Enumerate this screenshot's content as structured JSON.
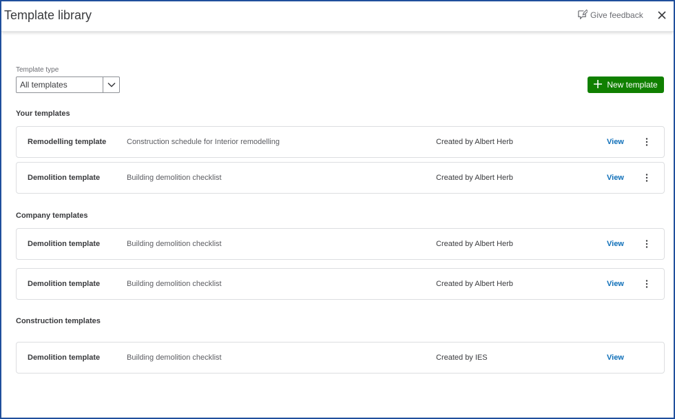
{
  "header": {
    "title": "Template library",
    "feedback_label": "Give feedback",
    "close_icon": "close-icon"
  },
  "filter": {
    "label": "Template type",
    "value": "All templates"
  },
  "new_button": {
    "label": "New template",
    "color": "#108000"
  },
  "accent": {
    "link": "#0d6eb8",
    "frame": "#1f4f9c"
  },
  "sections": [
    {
      "title": "Your templates",
      "rows": [
        {
          "name": "Remodelling template",
          "description": "Construction schedule for Interior remodelling",
          "creator": "Created by Albert Herb",
          "action": "View",
          "has_menu": true
        },
        {
          "name": "Demolition template",
          "description": "Building demolition checklist",
          "creator": "Created by Albert Herb",
          "action": "View",
          "has_menu": true
        }
      ]
    },
    {
      "title": "Company templates",
      "rows": [
        {
          "name": "Demolition template",
          "description": "Building demolition checklist",
          "creator": "Created by Albert Herb",
          "action": "View",
          "has_menu": true
        },
        {
          "name": "Demolition template",
          "description": "Building demolition checklist",
          "creator": "Created by Albert Herb",
          "action": "View",
          "has_menu": true
        }
      ]
    },
    {
      "title": "Construction templates",
      "rows": [
        {
          "name": "Demolition template",
          "description": "Building demolition checklist",
          "creator": "Created by IES",
          "action": "View",
          "has_menu": false
        }
      ]
    }
  ]
}
